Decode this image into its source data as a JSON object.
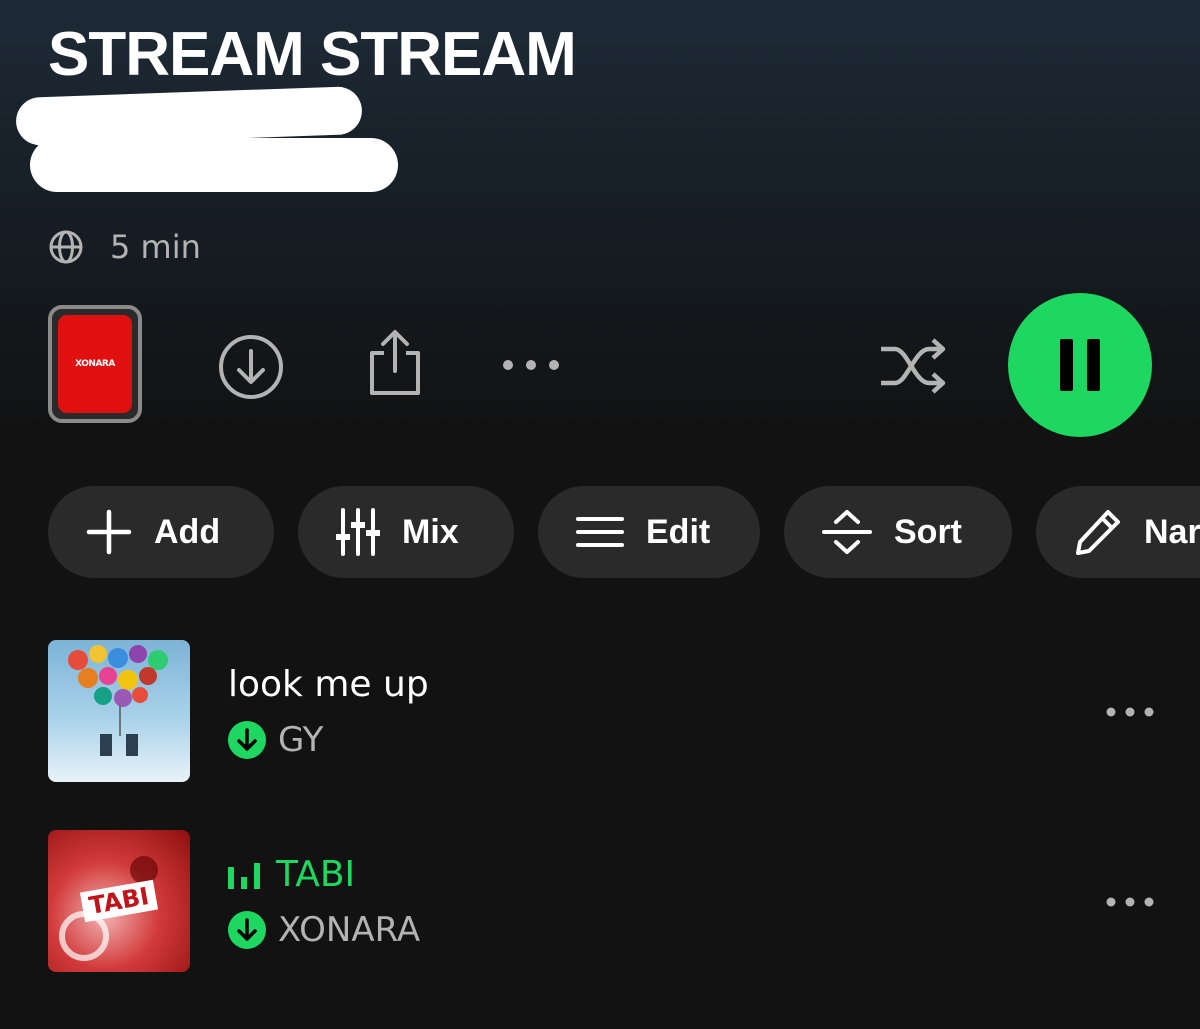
{
  "playlist": {
    "title": "STREAM STREAM",
    "duration": "5 min",
    "cover_text": "XONARA"
  },
  "controls": {
    "download_icon": "download-circle-icon",
    "share_icon": "share-icon",
    "more_icon": "more-horizontal-icon",
    "shuffle_icon": "shuffle-icon",
    "pause_icon": "pause-icon",
    "accent_color": "#1ed760"
  },
  "actions": [
    {
      "label": "Add",
      "icon": "plus-icon"
    },
    {
      "label": "Mix",
      "icon": "mixer-icon"
    },
    {
      "label": "Edit",
      "icon": "menu-lines-icon"
    },
    {
      "label": "Sort",
      "icon": "sort-icon"
    },
    {
      "label": "Nar",
      "icon": "pencil-icon"
    }
  ],
  "tracks": [
    {
      "title": "look me up",
      "artist": "GY",
      "downloaded": true,
      "playing": false
    },
    {
      "title": "TABI",
      "artist": "XONARA",
      "downloaded": true,
      "playing": true,
      "art_text": "TABI"
    }
  ]
}
